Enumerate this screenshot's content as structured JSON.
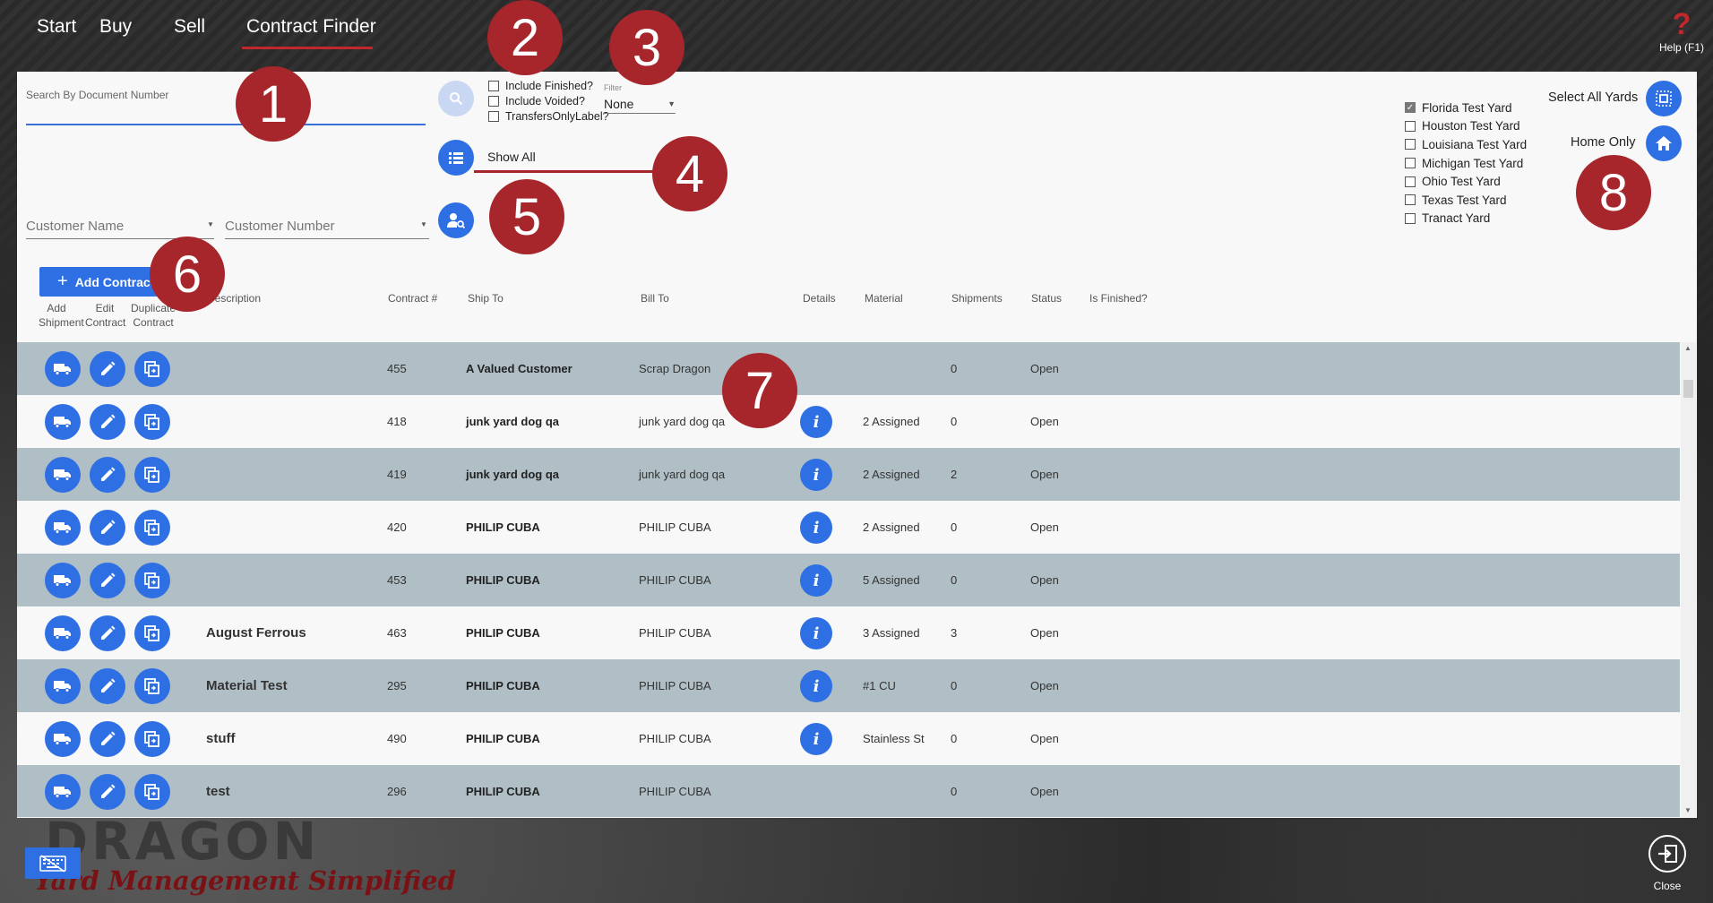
{
  "nav": {
    "start": "Start",
    "buy": "Buy",
    "sell": "Sell",
    "contract_finder": "Contract Finder"
  },
  "help": {
    "icon": "?",
    "label": "Help (F1)"
  },
  "search": {
    "doc_label": "Search By Document Number",
    "doc_value": ""
  },
  "options": {
    "include_finished": "Include Finished?",
    "include_voided": "Include Voided?",
    "transfers_only": "TransfersOnlyLabel?",
    "filter_label": "Filter",
    "filter_value": "None"
  },
  "show_all": "Show All",
  "customer": {
    "name_placeholder": "Customer Name",
    "number_placeholder": "Customer Number"
  },
  "add_contract": "Add Contract",
  "yards": {
    "items": [
      {
        "label": "Florida Test Yard",
        "checked": true
      },
      {
        "label": "Houston Test Yard",
        "checked": false
      },
      {
        "label": "Louisiana Test Yard",
        "checked": false
      },
      {
        "label": "Michigan Test Yard",
        "checked": false
      },
      {
        "label": "Ohio Test Yard",
        "checked": false
      },
      {
        "label": "Texas Test Yard",
        "checked": false
      },
      {
        "label": "Tranact Yard",
        "checked": false
      }
    ],
    "select_all": "Select All Yards",
    "home_only": "Home Only"
  },
  "columns": {
    "add_shipment_1": "Add",
    "add_shipment_2": "Shipment",
    "edit_contract_1": "Edit",
    "edit_contract_2": "Contract",
    "duplicate_1": "Duplicate",
    "duplicate_2": "Contract",
    "description": "Description",
    "contract_no": "Contract #",
    "ship_to": "Ship To",
    "bill_to": "Bill To",
    "details": "Details",
    "material": "Material",
    "shipments": "Shipments",
    "status": "Status",
    "is_finished": "Is Finished?"
  },
  "rows": [
    {
      "description": "",
      "contract": "455",
      "ship_to": "A Valued Customer",
      "bill_to": "Scrap Dragon",
      "details": false,
      "material": "",
      "shipments": "0",
      "status": "Open"
    },
    {
      "description": "",
      "contract": "418",
      "ship_to": "junk yard dog qa",
      "bill_to": "junk yard dog qa",
      "details": true,
      "material": "2 Assigned",
      "shipments": "0",
      "status": "Open"
    },
    {
      "description": "",
      "contract": "419",
      "ship_to": "junk yard dog qa",
      "bill_to": "junk yard dog qa",
      "details": true,
      "material": "2 Assigned",
      "shipments": "2",
      "status": "Open"
    },
    {
      "description": "",
      "contract": "420",
      "ship_to": "PHILIP CUBA",
      "bill_to": "PHILIP CUBA",
      "details": true,
      "material": "2 Assigned",
      "shipments": "0",
      "status": "Open"
    },
    {
      "description": "",
      "contract": "453",
      "ship_to": "PHILIP CUBA",
      "bill_to": "PHILIP CUBA",
      "details": true,
      "material": "5 Assigned",
      "shipments": "0",
      "status": "Open"
    },
    {
      "description": "August Ferrous",
      "contract": "463",
      "ship_to": "PHILIP CUBA",
      "bill_to": "PHILIP CUBA",
      "details": true,
      "material": "3 Assigned",
      "shipments": "3",
      "status": "Open"
    },
    {
      "description": "Material Test",
      "contract": "295",
      "ship_to": "PHILIP CUBA",
      "bill_to": "PHILIP CUBA",
      "details": true,
      "material": "#1 CU",
      "shipments": "0",
      "status": "Open"
    },
    {
      "description": "stuff",
      "contract": "490",
      "ship_to": "PHILIP CUBA",
      "bill_to": "PHILIP CUBA",
      "details": true,
      "material": "Stainless St",
      "shipments": "0",
      "status": "Open"
    },
    {
      "description": "test",
      "contract": "296",
      "ship_to": "PHILIP CUBA",
      "bill_to": "PHILIP CUBA",
      "details": false,
      "material": "",
      "shipments": "0",
      "status": "Open"
    }
  ],
  "details_glyph": "i",
  "markers": [
    "1",
    "2",
    "3",
    "4",
    "5",
    "6",
    "7",
    "8"
  ],
  "logo": {
    "line1": "DRAGON",
    "line2": "Yard Management Simplified"
  },
  "close_label": "Close",
  "colors": {
    "accent": "#2f6fe4",
    "marker": "#a6262b",
    "row_alt": "#b0bec5"
  }
}
